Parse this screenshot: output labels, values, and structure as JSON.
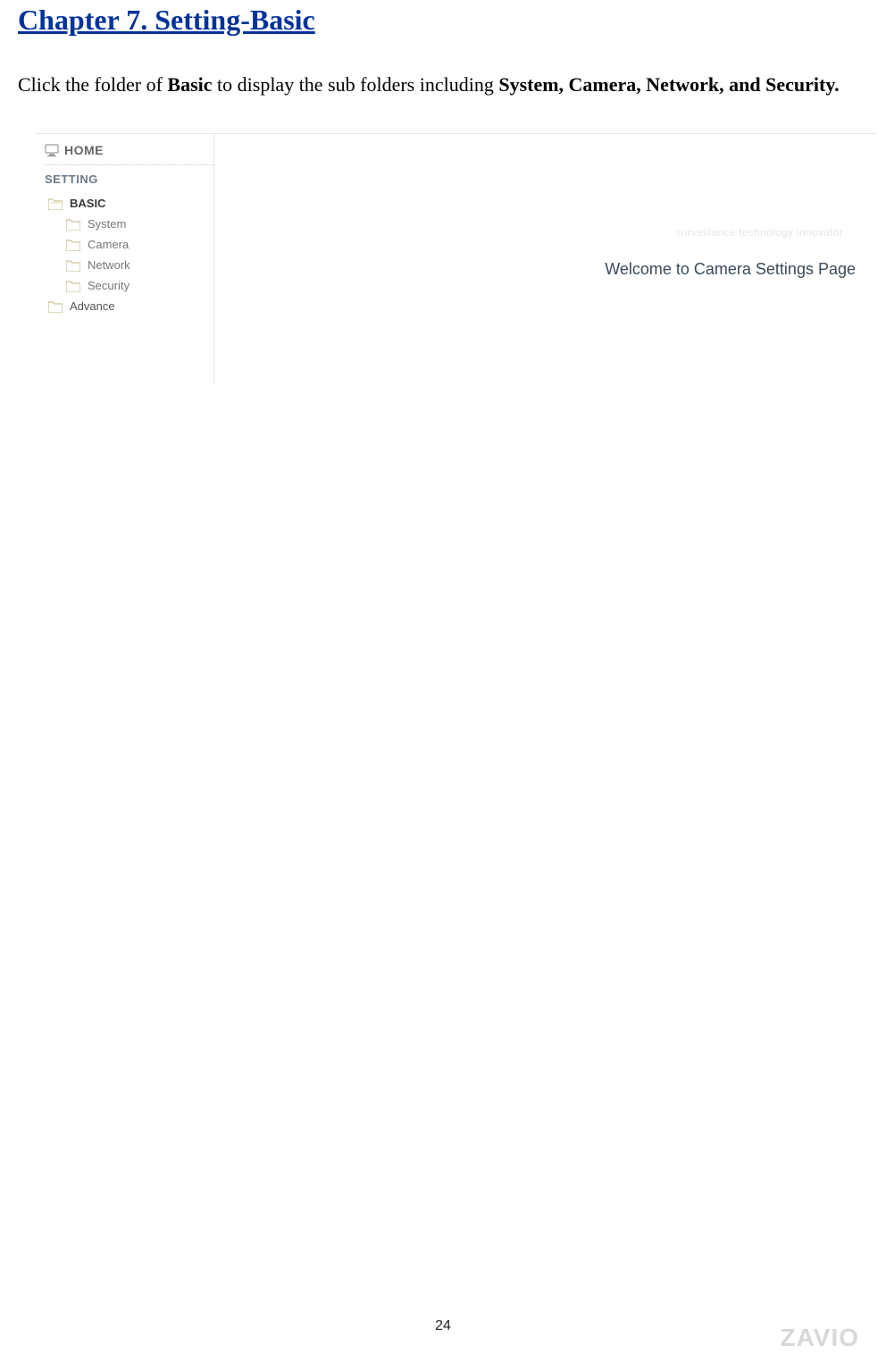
{
  "title": "Chapter 7. Setting-Basic      ",
  "intro": {
    "pre": "Click the folder of ",
    "bold1": "Basic",
    "mid": " to display the sub folders including ",
    "bold2": "System, Camera, Network, and Security."
  },
  "sidebar": {
    "home": "HOME",
    "setting": "SETTING",
    "items": [
      {
        "label": "BASIC",
        "bold": true,
        "indent": false
      },
      {
        "label": "System",
        "bold": false,
        "indent": true
      },
      {
        "label": "Camera",
        "bold": false,
        "indent": true
      },
      {
        "label": "Network",
        "bold": false,
        "indent": true
      },
      {
        "label": "Security",
        "bold": false,
        "indent": true
      },
      {
        "label": "Advance",
        "bold": false,
        "indent": false
      }
    ]
  },
  "main": {
    "faded": "surveillance technology innovator",
    "welcome": "Welcome to Camera Settings Page"
  },
  "page_number": "24",
  "brand": "ZAVIO"
}
